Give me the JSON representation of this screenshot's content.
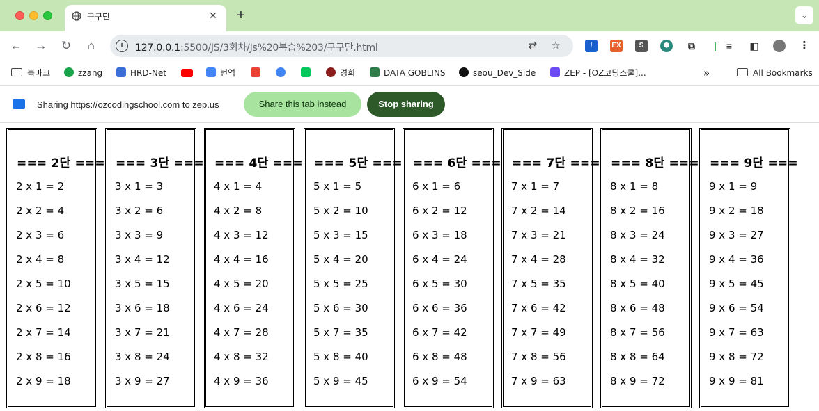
{
  "browser": {
    "tab_title": "구구단",
    "url_host": "127.0.0.1",
    "url_path": ":5500/JS/3회차/Js%20복습%203/구구단.html"
  },
  "bookmarks": [
    {
      "label": "북마크",
      "icon": "folder-icon"
    },
    {
      "label": "zzang",
      "icon": "cup-icon",
      "color": "#19a34a"
    },
    {
      "label": "HRD-Net",
      "icon": "hrd-icon",
      "color": "#3b6fd8"
    },
    {
      "label": "",
      "icon": "youtube-icon",
      "color": "#ff0000"
    },
    {
      "label": "번역",
      "icon": "translate-icon",
      "color": "#4285f4"
    },
    {
      "label": "",
      "icon": "gmail-icon",
      "color": "#ea4335"
    },
    {
      "label": "",
      "icon": "google-icon",
      "color": "#4285f4"
    },
    {
      "label": "",
      "icon": "naver-icon",
      "color": "#03c75a"
    },
    {
      "label": "경희",
      "icon": "khu-icon",
      "color": "#8b1d1d"
    },
    {
      "label": "DATA GOBLINS",
      "icon": "goblin-icon",
      "color": "#2f7d4a"
    },
    {
      "label": "seou_Dev_Side",
      "icon": "github-icon",
      "color": "#111111"
    },
    {
      "label": "ZEP - [OZ코딩스쿨]...",
      "icon": "zep-icon",
      "color": "#6c4bf4"
    },
    {
      "label": "All Bookmarks",
      "icon": "folder-icon"
    }
  ],
  "infobar": {
    "message": "Sharing https://ozcodingschool.com to zep.us",
    "share_tab_label": "Share this tab instead",
    "stop_label": "Stop sharing"
  },
  "tables": [
    {
      "title": "=== 2단 ===",
      "lines": [
        "2 x 1 = 2",
        "2 x 2 = 4",
        "2 x 3 = 6",
        "2 x 4 = 8",
        "2 x 5 = 10",
        "2 x 6 = 12",
        "2 x 7 = 14",
        "2 x 8 = 16",
        "2 x 9 = 18"
      ]
    },
    {
      "title": "=== 3단 ===",
      "lines": [
        "3 x 1 = 3",
        "3 x 2 = 6",
        "3 x 3 = 9",
        "3 x 4 = 12",
        "3 x 5 = 15",
        "3 x 6 = 18",
        "3 x 7 = 21",
        "3 x 8 = 24",
        "3 x 9 = 27"
      ]
    },
    {
      "title": "=== 4단 ===",
      "lines": [
        "4 x 1 = 4",
        "4 x 2 = 8",
        "4 x 3 = 12",
        "4 x 4 = 16",
        "4 x 5 = 20",
        "4 x 6 = 24",
        "4 x 7 = 28",
        "4 x 8 = 32",
        "4 x 9 = 36"
      ]
    },
    {
      "title": "=== 5단 ===",
      "lines": [
        "5 x 1 = 5",
        "5 x 2 = 10",
        "5 x 3 = 15",
        "5 x 4 = 20",
        "5 x 5 = 25",
        "5 x 6 = 30",
        "5 x 7 = 35",
        "5 x 8 = 40",
        "5 x 9 = 45"
      ]
    },
    {
      "title": "=== 6단 ===",
      "lines": [
        "6 x 1 = 6",
        "6 x 2 = 12",
        "6 x 3 = 18",
        "6 x 4 = 24",
        "6 x 5 = 30",
        "6 x 6 = 36",
        "6 x 7 = 42",
        "6 x 8 = 48",
        "6 x 9 = 54"
      ]
    },
    {
      "title": "=== 7단 ===",
      "lines": [
        "7 x 1 = 7",
        "7 x 2 = 14",
        "7 x 3 = 21",
        "7 x 4 = 28",
        "7 x 5 = 35",
        "7 x 6 = 42",
        "7 x 7 = 49",
        "7 x 8 = 56",
        "7 x 9 = 63"
      ]
    },
    {
      "title": "=== 8단 ===",
      "lines": [
        "8 x 1 = 8",
        "8 x 2 = 16",
        "8 x 3 = 24",
        "8 x 4 = 32",
        "8 x 5 = 40",
        "8 x 6 = 48",
        "8 x 7 = 56",
        "8 x 8 = 64",
        "8 x 9 = 72"
      ]
    },
    {
      "title": "=== 9단 ===",
      "lines": [
        "9 x 1 = 9",
        "9 x 2 = 18",
        "9 x 3 = 27",
        "9 x 4 = 36",
        "9 x 5 = 45",
        "9 x 6 = 54",
        "9 x 7 = 63",
        "9 x 8 = 72",
        "9 x 9 = 81"
      ]
    }
  ]
}
